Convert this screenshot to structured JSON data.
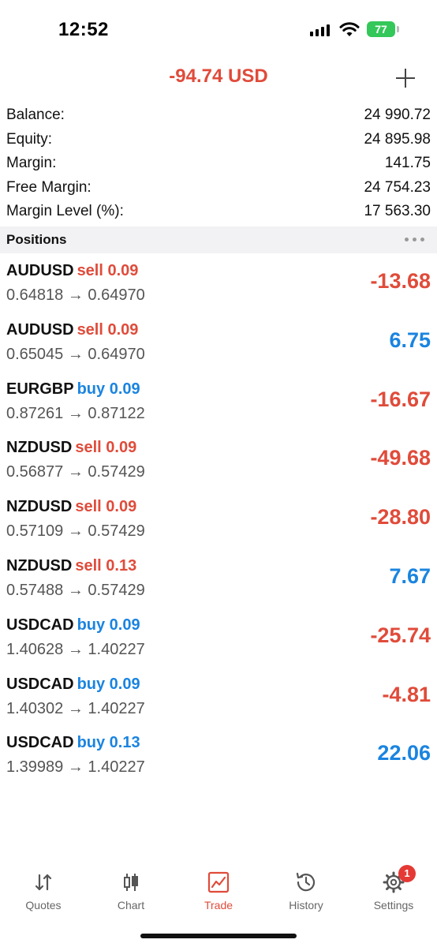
{
  "status_bar": {
    "time": "12:52",
    "battery": "77"
  },
  "header": {
    "total_profit": "-94.74 USD",
    "add_icon": "plus-icon"
  },
  "account": [
    {
      "label": "Balance:",
      "value": "24 990.72"
    },
    {
      "label": "Equity:",
      "value": "24 895.98"
    },
    {
      "label": "Margin:",
      "value": "141.75"
    },
    {
      "label": "Free Margin:",
      "value": "24 754.23"
    },
    {
      "label": "Margin Level (%):",
      "value": "17 563.30"
    }
  ],
  "positions_header": {
    "title": "Positions",
    "more_icon": "more-dots-icon"
  },
  "positions": [
    {
      "symbol": "AUDUSD",
      "side": "sell 0.09",
      "prices": "0.64818 → 0.64970",
      "profit": "-13.68"
    },
    {
      "symbol": "AUDUSD",
      "side": "sell 0.09",
      "prices": "0.65045 → 0.64970",
      "profit": "6.75"
    },
    {
      "symbol": "EURGBP",
      "side": "buy 0.09",
      "prices": "0.87261 → 0.87122",
      "profit": "-16.67"
    },
    {
      "symbol": "NZDUSD",
      "side": "sell 0.09",
      "prices": "0.56877 → 0.57429",
      "profit": "-49.68"
    },
    {
      "symbol": "NZDUSD",
      "side": "sell 0.09",
      "prices": "0.57109 → 0.57429",
      "profit": "-28.80"
    },
    {
      "symbol": "NZDUSD",
      "side": "sell 0.13",
      "prices": "0.57488 → 0.57429",
      "profit": "7.67"
    },
    {
      "symbol": "USDCAD",
      "side": "buy 0.09",
      "prices": "1.40628 → 1.40227",
      "profit": "-25.74"
    },
    {
      "symbol": "USDCAD",
      "side": "buy 0.09",
      "prices": "1.40302 → 1.40227",
      "profit": "-4.81"
    },
    {
      "symbol": "USDCAD",
      "side": "buy 0.13",
      "prices": "1.39989 → 1.40227",
      "profit": "22.06"
    }
  ],
  "tabs": [
    {
      "label": "Quotes",
      "icon": "quotes-arrows-icon"
    },
    {
      "label": "Chart",
      "icon": "candlestick-chart-icon"
    },
    {
      "label": "Trade",
      "icon": "trade-chart-icon",
      "active": true
    },
    {
      "label": "History",
      "icon": "history-clock-icon"
    },
    {
      "label": "Settings",
      "icon": "gear-icon",
      "badge": "1"
    }
  ],
  "colors": {
    "negative": "#e04b3a",
    "positive": "#1a84e0",
    "active_tab": "#e04b3a",
    "battery": "#34c759"
  }
}
